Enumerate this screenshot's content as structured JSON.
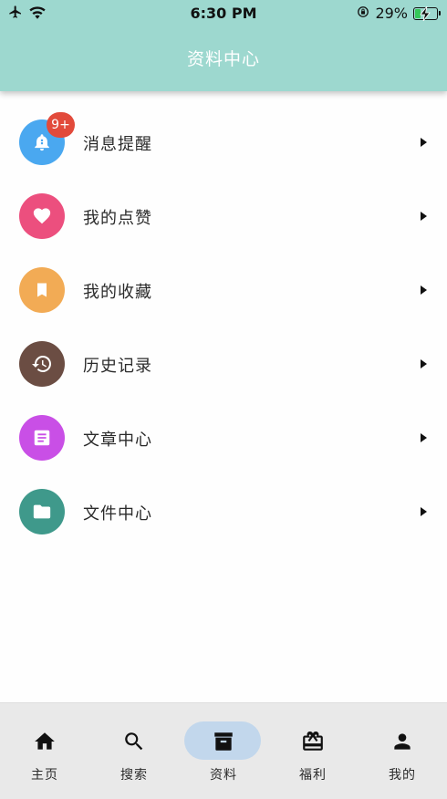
{
  "status_bar": {
    "time": "6:30 PM",
    "battery_percent": "29%",
    "battery_level": 0.29,
    "icons": [
      "airplane-icon",
      "wifi-icon",
      "orientation-lock-icon",
      "battery-icon"
    ]
  },
  "header": {
    "title": "资料中心",
    "background": "#9dd8cf"
  },
  "menu": {
    "items": [
      {
        "label": "消息提醒",
        "icon": "bell-icon",
        "color": "#4aa8f0",
        "badge": "9+"
      },
      {
        "label": "我的点赞",
        "icon": "heart-icon",
        "color": "#ec4f7e"
      },
      {
        "label": "我的收藏",
        "icon": "bookmark-icon",
        "color": "#f2ab55"
      },
      {
        "label": "历史记录",
        "icon": "history-icon",
        "color": "#6b4d43"
      },
      {
        "label": "文章中心",
        "icon": "article-icon",
        "color": "#c94fe6"
      },
      {
        "label": "文件中心",
        "icon": "folder-icon",
        "color": "#3f998b"
      }
    ]
  },
  "bottom_nav": {
    "active_index": 2,
    "items": [
      {
        "label": "主页",
        "icon": "home-icon"
      },
      {
        "label": "搜索",
        "icon": "search-icon"
      },
      {
        "label": "资料",
        "icon": "archive-icon"
      },
      {
        "label": "福利",
        "icon": "gift-card-icon"
      },
      {
        "label": "我的",
        "icon": "person-icon"
      }
    ],
    "active_pill_color": "#c2d7ec"
  }
}
